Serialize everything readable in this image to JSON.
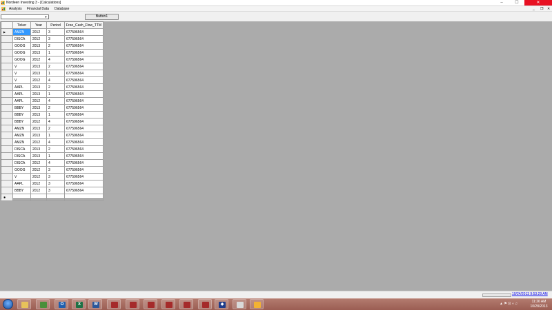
{
  "window": {
    "title": "Nordeen Investing 3 - [Calculations]",
    "min_glyph": "–",
    "max_glyph": "☐",
    "close_glyph": "✕"
  },
  "menu": {
    "items": [
      "Analysis",
      "Financial Data",
      "Database"
    ],
    "mdi_min": "_",
    "mdi_restore": "❐",
    "mdi_close": "✕"
  },
  "toolbar": {
    "combo_value": "",
    "combo_arrow": "▼",
    "button1_label": "Button1"
  },
  "grid": {
    "columns": [
      "Ticker",
      "Year",
      "Period",
      "Free_Cash_Flow_TTM"
    ],
    "current_row_marker": "▶",
    "new_row_marker": "✱",
    "rows": [
      [
        "AMZN",
        "2012",
        "3",
        "677596564"
      ],
      [
        "DISCA",
        "2012",
        "3",
        "677596564"
      ],
      [
        "GOOG",
        "2013",
        "2",
        "677596564"
      ],
      [
        "GOOG",
        "2013",
        "1",
        "677596564"
      ],
      [
        "GOOG",
        "2012",
        "4",
        "677596564"
      ],
      [
        "V",
        "2013",
        "2",
        "677596564"
      ],
      [
        "V",
        "2013",
        "1",
        "677596564"
      ],
      [
        "V",
        "2012",
        "4",
        "677596564"
      ],
      [
        "AAPL",
        "2013",
        "2",
        "677596564"
      ],
      [
        "AAPL",
        "2013",
        "1",
        "677596564"
      ],
      [
        "AAPL",
        "2012",
        "4",
        "677596564"
      ],
      [
        "BBBY",
        "2013",
        "2",
        "677596564"
      ],
      [
        "BBBY",
        "2013",
        "1",
        "677596564"
      ],
      [
        "BBBY",
        "2012",
        "4",
        "677596564"
      ],
      [
        "AMZN",
        "2013",
        "2",
        "677596564"
      ],
      [
        "AMZN",
        "2013",
        "1",
        "677596564"
      ],
      [
        "AMZN",
        "2012",
        "4",
        "677596564"
      ],
      [
        "DISCA",
        "2013",
        "2",
        "677596564"
      ],
      [
        "DISCA",
        "2013",
        "1",
        "677596564"
      ],
      [
        "DISCA",
        "2012",
        "4",
        "677596564"
      ],
      [
        "GOOG",
        "2012",
        "3",
        "677596564"
      ],
      [
        "V",
        "2012",
        "3",
        "677596564"
      ],
      [
        "AAPL",
        "2012",
        "3",
        "677596564"
      ],
      [
        "BBBY",
        "2012",
        "3",
        "677596564"
      ]
    ]
  },
  "status": {
    "progress_fraction": 0,
    "link_text": "10/24/2013 9:53:29 AM"
  },
  "taskbar": {
    "apps": [
      {
        "icon": "explorer-icon",
        "glyph": "",
        "color": "#e8c25a"
      },
      {
        "icon": "chrome-icon",
        "glyph": "",
        "color": "#4a8f3a"
      },
      {
        "icon": "outlook-icon",
        "glyph": "O",
        "color": "#1f5fae"
      },
      {
        "icon": "excel-icon",
        "glyph": "X",
        "color": "#1e7145"
      },
      {
        "icon": "word-icon",
        "glyph": "W",
        "color": "#2b579a"
      },
      {
        "icon": "sql-server-icon",
        "glyph": "",
        "color": "#a52a2a"
      },
      {
        "icon": "sql-server-icon",
        "glyph": "",
        "color": "#a52a2a"
      },
      {
        "icon": "sql-server-icon",
        "glyph": "",
        "color": "#a52a2a"
      },
      {
        "icon": "sql-server-icon",
        "glyph": "",
        "color": "#a52a2a"
      },
      {
        "icon": "sql-server-icon",
        "glyph": "",
        "color": "#a52a2a"
      },
      {
        "icon": "sql-server-icon",
        "glyph": "",
        "color": "#a52a2a"
      },
      {
        "icon": "visual-studio-icon",
        "glyph": "◆",
        "color": "#1f3c8a"
      },
      {
        "icon": "app-window-icon",
        "glyph": "",
        "color": "#d9d9d9"
      },
      {
        "icon": "app-window-icon",
        "glyph": "",
        "color": "#f2b233"
      }
    ],
    "tray_icons": "▲ ⚑ ⊡ ◖ ♫",
    "clock_time": "11:26 AM",
    "clock_date": "10/28/2013"
  },
  "colors": {
    "selection": "#3399ff",
    "workspace": "#ababab",
    "close_button": "#e81123"
  }
}
